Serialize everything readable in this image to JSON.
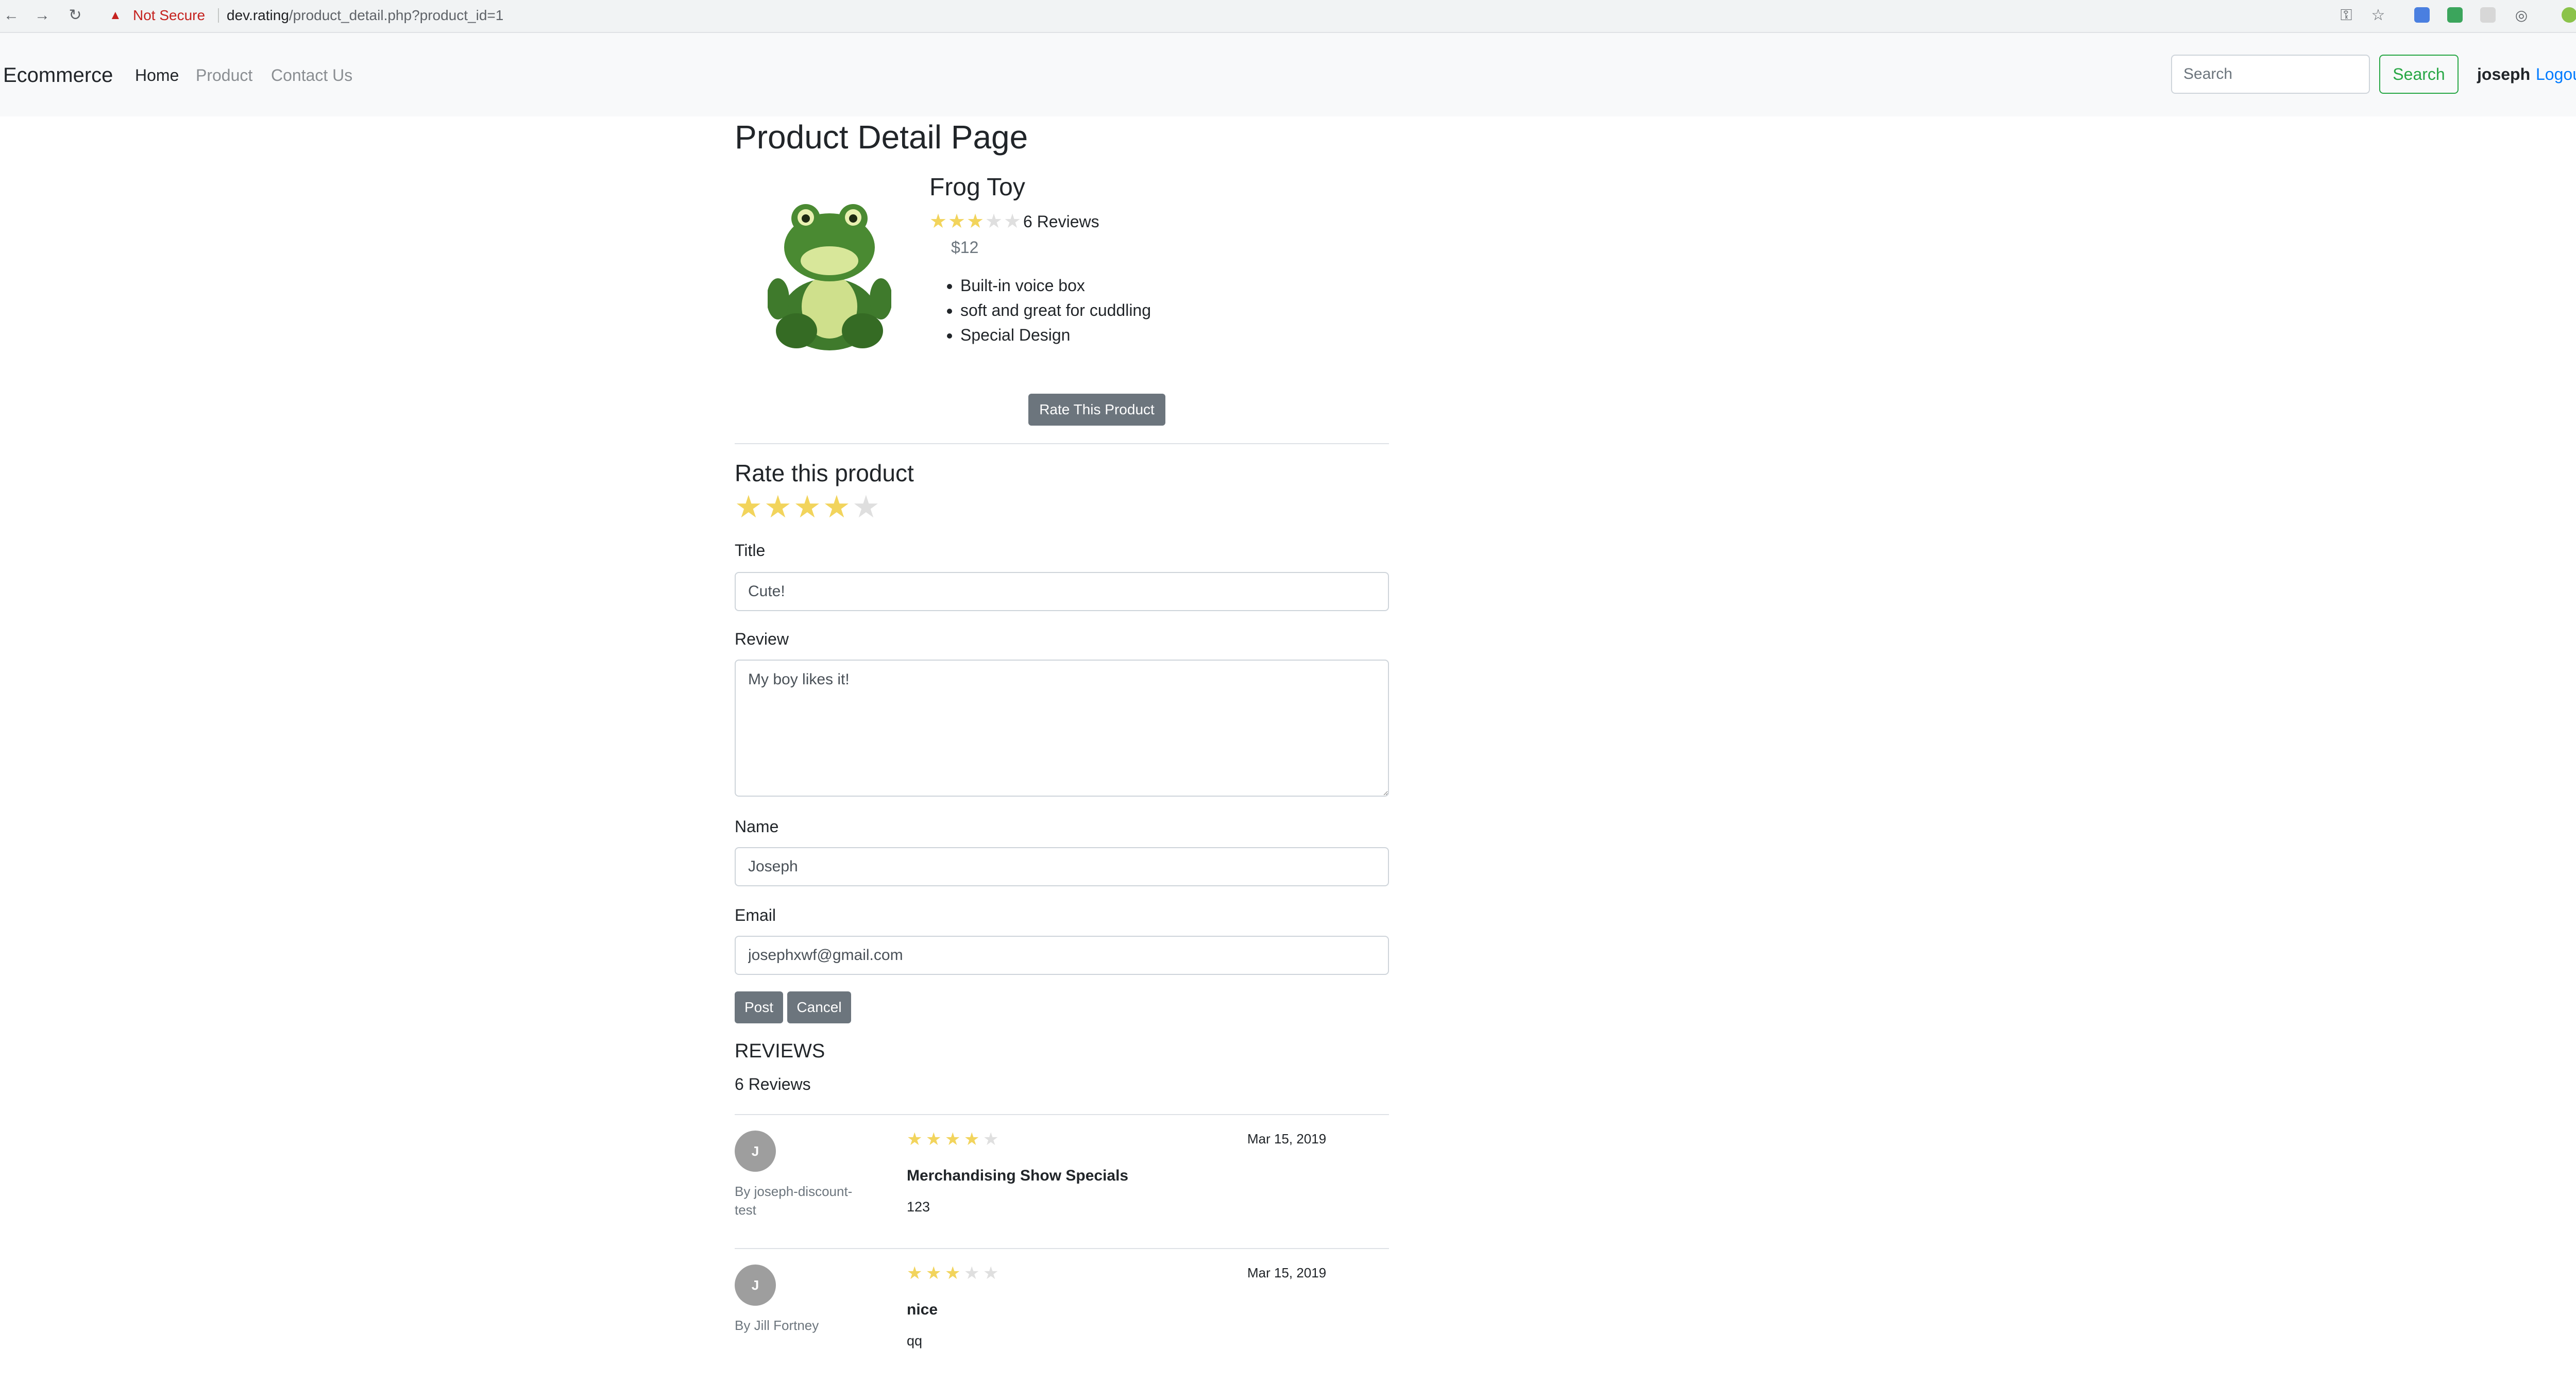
{
  "browser": {
    "back_icon": "←",
    "forward_icon": "→",
    "reload_icon": "↻",
    "warning_icon": "▲",
    "security_label": "Not Secure",
    "url_host": "dev.rating",
    "url_path": "/product_detail.php?product_id=1",
    "key_icon": "⚿",
    "bookmark_icon": "☆",
    "menu_icon": "⋮"
  },
  "navbar": {
    "brand": "Ecommerce",
    "links": [
      {
        "label": "Home"
      },
      {
        "label": "Product"
      },
      {
        "label": "Contact Us"
      }
    ],
    "search_placeholder": "Search",
    "search_button": "Search",
    "username": "joseph",
    "logout": "Logout"
  },
  "product": {
    "page_title": "Product Detail Page",
    "name": "Frog Toy",
    "rating": 3,
    "max_rating": 5,
    "review_count_label": "6 Reviews",
    "price": "$12",
    "features": [
      "Built-in voice box",
      "soft and great for cuddling",
      "Special Design"
    ],
    "rate_button": "Rate This Product"
  },
  "rate_form": {
    "heading": "Rate this product",
    "selected_rating": 4,
    "title_label": "Title",
    "title_value": "Cute!",
    "review_label": "Review",
    "review_value": "My boy likes it!",
    "name_label": "Name",
    "name_value": "Joseph",
    "email_label": "Email",
    "email_value": "josephxwf@gmail.com",
    "post_button": "Post",
    "cancel_button": "Cancel"
  },
  "reviews": {
    "heading": "REVIEWS",
    "count_label": "6 Reviews",
    "items": [
      {
        "initial": "J",
        "author": "By joseph-discount-test",
        "rating": 4,
        "date": "Mar 15, 2019",
        "title": "Merchandising Show Specials",
        "body": "123"
      },
      {
        "initial": "J",
        "author": "By Jill Fortney",
        "rating": 3,
        "date": "Mar 15, 2019",
        "title": "nice",
        "body": "qq"
      }
    ]
  },
  "colors": {
    "star_filled": "#f2d45c",
    "star_empty": "#dfdfdf",
    "button_secondary": "#6c757d",
    "search_green": "#28a745",
    "link_blue": "#007bff",
    "warning_red": "#c5221f"
  }
}
